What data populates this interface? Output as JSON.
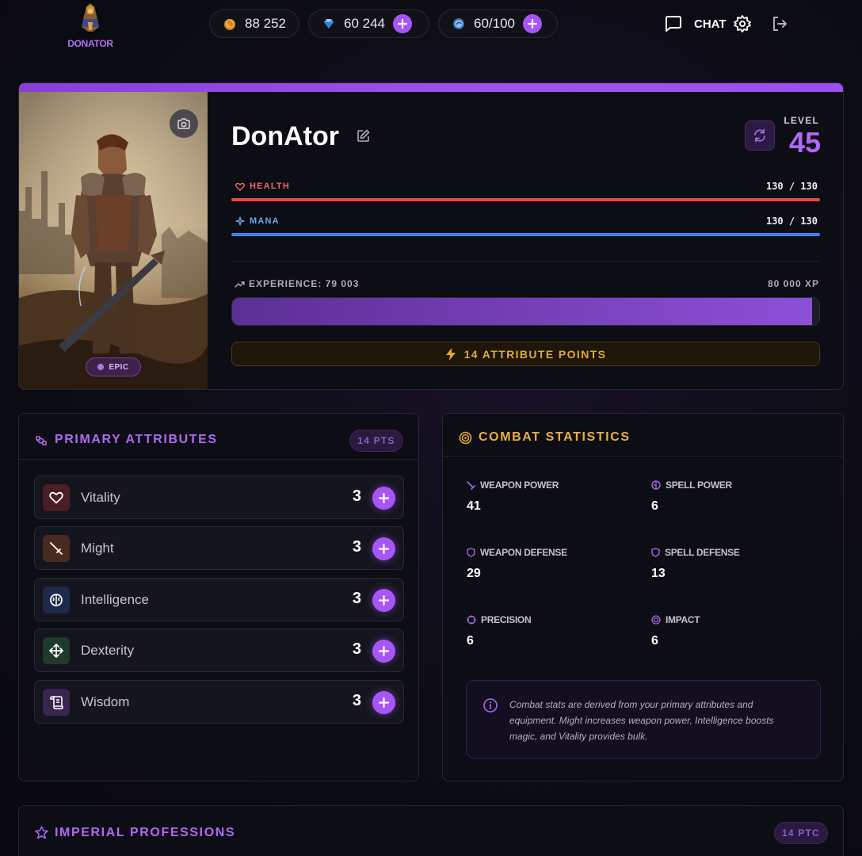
{
  "header": {
    "logo_text": "DONATOR",
    "gold": "88 252",
    "gems": "60 244",
    "energy": "60/100",
    "chat_label": "CHAT"
  },
  "character": {
    "name": "DonAtor",
    "rarity": "EPIC",
    "level_label": "LEVEL",
    "level": "45",
    "health_label": "HEALTH",
    "health_text": "130 / 130",
    "health_fraction": 1.0,
    "mana_label": "MANA",
    "mana_text": "130 / 130",
    "mana_fraction": 1.0,
    "experience_label": "EXPERIENCE: 79 003",
    "experience_max": "80 000 XP",
    "experience_fraction": 0.9875,
    "attribute_points_button": "14 ATTRIBUTE POINTS"
  },
  "primary_attributes": {
    "title": "PRIMARY ATTRIBUTES",
    "points_badge": "14 PTS",
    "items": [
      {
        "name": "Vitality",
        "value": "3",
        "icon": "heart-icon",
        "color": "#e06a6a"
      },
      {
        "name": "Might",
        "value": "3",
        "icon": "sword-icon",
        "color": "#e09a6a"
      },
      {
        "name": "Intelligence",
        "value": "3",
        "icon": "brain-icon",
        "color": "#7aa8f0"
      },
      {
        "name": "Dexterity",
        "value": "3",
        "icon": "move-icon",
        "color": "#6ad09a"
      },
      {
        "name": "Wisdom",
        "value": "3",
        "icon": "scroll-icon",
        "color": "#c09af0"
      }
    ]
  },
  "combat_statistics": {
    "title": "COMBAT STATISTICS",
    "stats": [
      {
        "label": "WEAPON POWER",
        "value": "41",
        "icon": "sword-icon"
      },
      {
        "label": "SPELL POWER",
        "value": "6",
        "icon": "spell-icon"
      },
      {
        "label": "WEAPON DEFENSE",
        "value": "29",
        "icon": "shield-icon"
      },
      {
        "label": "SPELL DEFENSE",
        "value": "13",
        "icon": "shield-icon"
      },
      {
        "label": "PRECISION",
        "value": "6",
        "icon": "crosshair-icon"
      },
      {
        "label": "IMPACT",
        "value": "6",
        "icon": "target-icon"
      }
    ],
    "info_text": "Combat stats are derived from your primary attributes and equipment. Might increases weapon power, Intelligence boosts magic, and Vitality provides bulk."
  },
  "professions": {
    "title": "IMPERIAL PROFESSIONS",
    "points_badge": "14 PTC"
  },
  "colors": {
    "accent": "#a855f7",
    "health": "#ef4444",
    "mana": "#3b82f6",
    "gold": "#e0a83c"
  }
}
